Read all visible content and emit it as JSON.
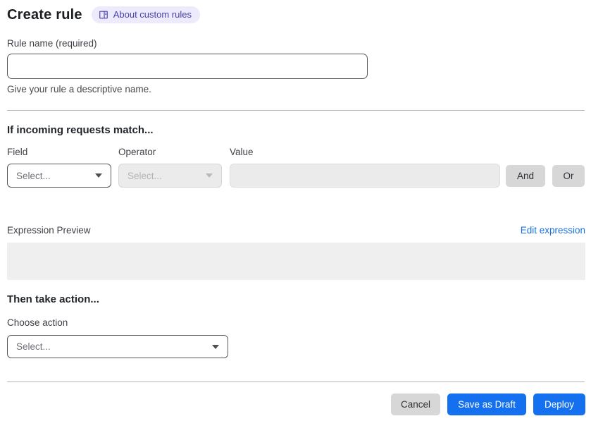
{
  "header": {
    "title": "Create rule",
    "badge": {
      "label": "About custom rules",
      "icon": "book-icon"
    }
  },
  "rule_name": {
    "label": "Rule name (required)",
    "value": "",
    "placeholder": "",
    "help": "Give your rule a descriptive name."
  },
  "match_section": {
    "heading": "If incoming requests match...",
    "field": {
      "label": "Field",
      "selected": "Select..."
    },
    "operator": {
      "label": "Operator",
      "selected": "Select...",
      "disabled": true
    },
    "value_input": {
      "label": "Value",
      "value": "",
      "disabled": true
    },
    "and_button": "And",
    "or_button": "Or"
  },
  "expression": {
    "label": "Expression Preview",
    "edit_link": "Edit expression",
    "content": ""
  },
  "action_section": {
    "heading": "Then take action...",
    "choose_label": "Choose action",
    "selected": "Select..."
  },
  "footer": {
    "cancel": "Cancel",
    "save_draft": "Save as Draft",
    "deploy": "Deploy"
  },
  "colors": {
    "primary_blue": "#1570ef",
    "link_blue": "#1a70dc",
    "badge_bg": "#eceafb",
    "badge_text": "#4741ab",
    "disabled_bg": "#ebebeb",
    "gray_button": "#d7d7d7",
    "divider": "#b4b4b4"
  }
}
